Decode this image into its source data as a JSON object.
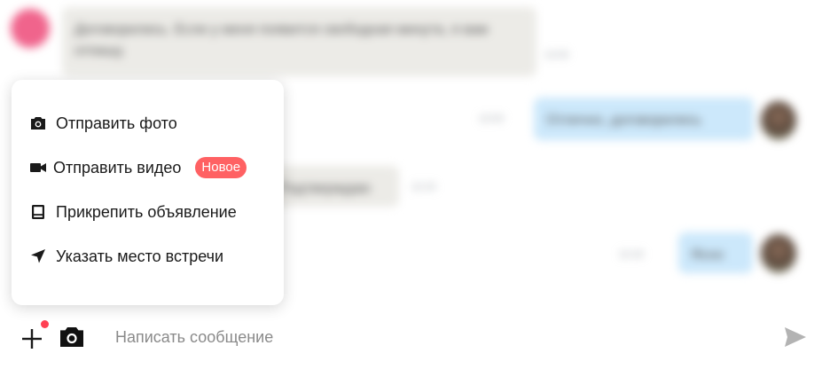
{
  "chat": {
    "messages": [
      {
        "text": "Договорились. Если у меня появится свободная минута, я вам отпишу.",
        "time": "12:02",
        "side": "incoming"
      },
      {
        "text": "Отлично, договорились",
        "time": "12:03",
        "side": "outgoing"
      },
      {
        "text": "Подтверждаю",
        "time": "12:15",
        "side": "incoming"
      },
      {
        "text": "Ясно",
        "time": "12:16",
        "side": "outgoing"
      }
    ]
  },
  "menu": {
    "items": [
      {
        "label": "Отправить фото",
        "icon": "camera-icon"
      },
      {
        "label": "Отправить видео",
        "icon": "video-icon",
        "badge": "Новое"
      },
      {
        "label": "Прикрепить объявление",
        "icon": "listing-icon"
      },
      {
        "label": "Указать место встречи",
        "icon": "location-arrow-icon"
      }
    ]
  },
  "composer": {
    "placeholder": "Написать сообщение"
  },
  "colors": {
    "badge": "#ff6163",
    "notification_dot": "#ff4053",
    "outgoing_bubble": "#cce8fb",
    "incoming_bubble": "#ecebe7",
    "send_icon": "#b3b3b3"
  }
}
